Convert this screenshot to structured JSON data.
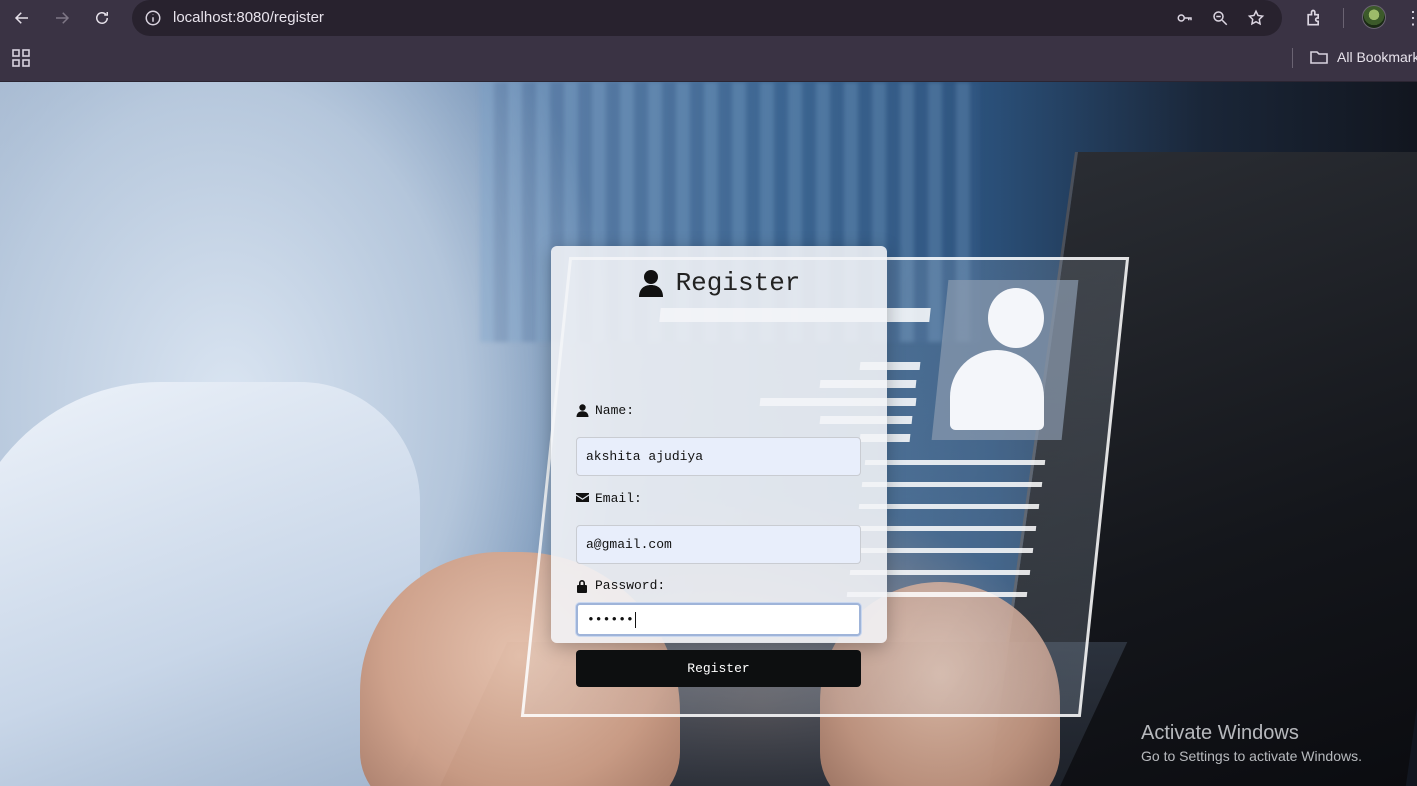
{
  "browser": {
    "url": "localhost:8080/register",
    "bookmarks_label": "All Bookmark"
  },
  "form": {
    "title": "Register",
    "name": {
      "label": "Name:",
      "value": "akshita ajudiya"
    },
    "email": {
      "label": "Email:",
      "value": "a@gmail.com"
    },
    "password": {
      "label": "Password:",
      "value": "••••••"
    },
    "submit_label": "Register"
  },
  "watermark": {
    "line1": "Activate Windows",
    "line2": "Go to Settings to activate Windows."
  },
  "icons": {
    "title": "user-icon",
    "name": "user-icon",
    "email": "envelope-icon",
    "password": "lock-icon"
  },
  "colors": {
    "chrome_bg": "#3a3344",
    "button_bg": "#0d0f10",
    "input_bg": "#e8eefb"
  }
}
